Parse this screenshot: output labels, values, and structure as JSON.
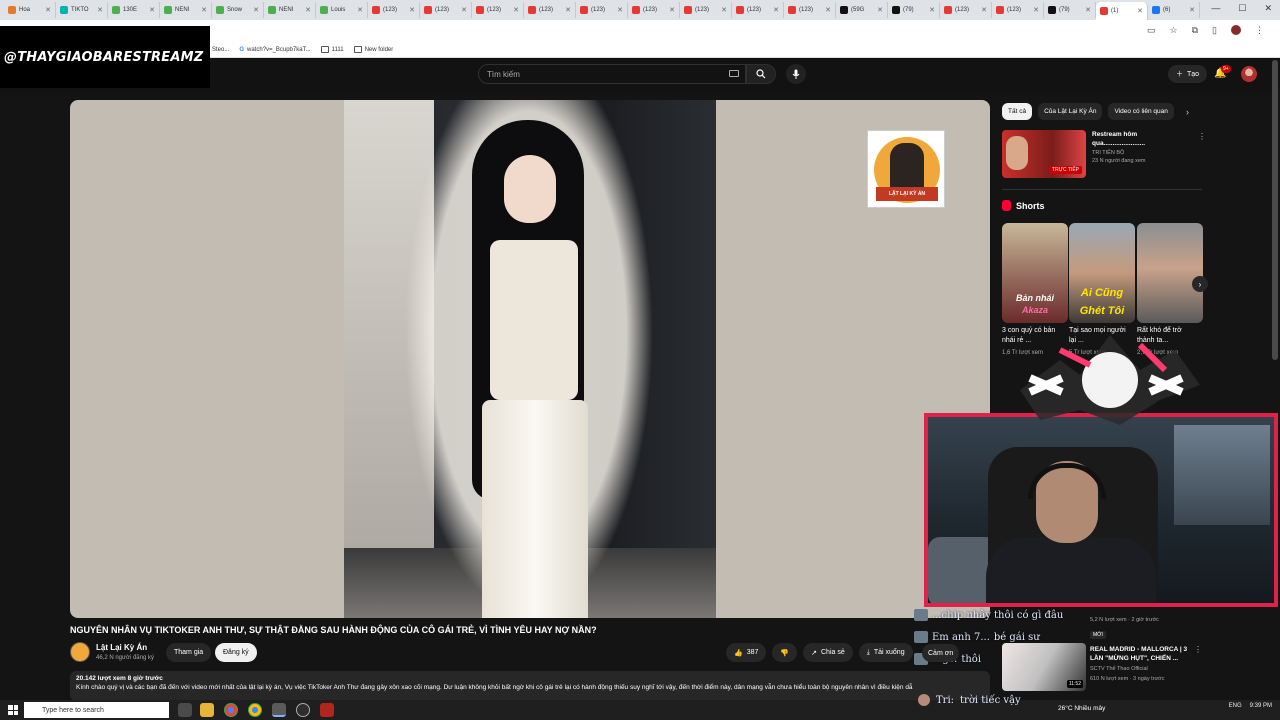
{
  "browser": {
    "tabs": [
      {
        "label": "Hoa",
        "color": "#e37b2b"
      },
      {
        "label": "TIKTO",
        "color": "#00b3b3"
      },
      {
        "label": "130E",
        "color": "#4caf50"
      },
      {
        "label": "NENI",
        "color": "#4caf50"
      },
      {
        "label": "Snow",
        "color": "#4caf50"
      },
      {
        "label": "NENI",
        "color": "#4caf50"
      },
      {
        "label": "Louis",
        "color": "#4caf50"
      },
      {
        "label": "(123)",
        "color": "#e53935"
      },
      {
        "label": "(123)",
        "color": "#e53935"
      },
      {
        "label": "(123)",
        "color": "#e53935"
      },
      {
        "label": "(123)",
        "color": "#e53935"
      },
      {
        "label": "(123)",
        "color": "#e53935"
      },
      {
        "label": "(123)",
        "color": "#e53935"
      },
      {
        "label": "(123)",
        "color": "#e53935"
      },
      {
        "label": "(123)",
        "color": "#e53935"
      },
      {
        "label": "(123)",
        "color": "#e53935"
      },
      {
        "label": "(59G",
        "color": "#111111"
      },
      {
        "label": "(79)",
        "color": "#111111"
      },
      {
        "label": "(123)",
        "color": "#e53935"
      },
      {
        "label": "(123)",
        "color": "#e53935"
      },
      {
        "label": "(79)",
        "color": "#111111"
      },
      {
        "label": "(1)",
        "color": "#e53935",
        "active": true
      },
      {
        "label": "(6)",
        "color": "#1877f2"
      }
    ],
    "bookmarks": [
      "Steo...",
      "watch?v=_Bcupb7kaT...",
      "1111",
      "New folder"
    ]
  },
  "watermark": "@THAYGIAOBARESTREAMZ",
  "header": {
    "search_placeholder": "Tìm kiếm",
    "create_label": "Tạo",
    "notif_count": "9+"
  },
  "player": {
    "logo_banner": "LẬT LẠI KỲ ÁN"
  },
  "video": {
    "title": "NGUYÊN NHÂN VỤ TIKTOKER ANH THƯ, SỰ THẬT ĐẰNG SAU HÀNH ĐỘNG CỦA CÔ GÁI TRẺ, VÌ TÌNH YÊU HAY NỢ NẦN?",
    "channel": "Lật Lại Kỳ Án",
    "subscribers": "46,2 N người đăng ký",
    "join_label": "Tham gia",
    "subscribe_label": "Đăng ký",
    "likes": "387",
    "thanks_label": "Cảm ơn",
    "share_label": "Chia sẻ",
    "download_label": "Tải xuống",
    "views_time": "20.142 lượt xem  8 giờ trước",
    "description": "Kính chào quý vị và các bạn đã đến với video mới nhất của lật lại kỳ án, Vụ việc TikToker Anh Thư đang gây xôn xao cõi mạng. Dư luận không khỏi bất ngờ khi cô gái trẻ lại có hành động thiếu suy nghĩ tới vậy, đến thời điểm này, dân mạng vẫn chưa hiểu toàn bộ nguyên nhân vì điều kiện dẫ"
  },
  "sidebar": {
    "chips": [
      "Tất cả",
      "Của Lật Lại Kỳ Án",
      "Video có liên quan"
    ],
    "recommendation": {
      "title": "Restream hôm qua.......................",
      "channel": "TRI TIẾN BỘ",
      "meta": "23 N người đang xem",
      "thumb_text": "TRỰC TIẾP"
    },
    "shorts_label": "Shorts",
    "shorts": [
      {
        "caption": "Bản nhái",
        "caption2": "Akaza",
        "title": "3 con quỷ có bản nhái rẻ ...",
        "views": "1,6 Tr lượt xem"
      },
      {
        "caption": "Ai Cũng",
        "caption2": "Ghét Tôi",
        "title": "Tại sao mọi người lại ...",
        "views": "5 Tr lượt xem"
      },
      {
        "caption": "",
        "caption2": "",
        "title": "Rất khó để trở thành ta...",
        "views": "2,7 Tr lượt xem"
      }
    ],
    "bottom_rec": {
      "title": "REAL MADRID - MALLORCA | 3 LẦN \"MỪNG HỤT\", CHIẾN ...",
      "channel": "SCTV Thể Thao Official",
      "meta": "610 N lượt xem · 3 ngày trước",
      "duration": "11:52"
    },
    "top_rec2": {
      "title": "...",
      "meta": "5,2 N lượt xem · 2 giờ trước",
      "badge": "MỚI"
    }
  },
  "stream_chat": [
    {
      "user": "",
      "text": "...chip nhây thôi có gì đâu"
    },
    {
      "user": "Em anh 7...",
      "text": "bé gái sư"
    },
    {
      "user": "dtgs:",
      "text": "thôi"
    }
  ],
  "bottom_chat": {
    "user": "Tri:",
    "text": "trời tiếc vậy"
  },
  "taskbar": {
    "search_placeholder": "Type here to search",
    "weather": "26°C  Nhiều mây",
    "lang": "ENG",
    "time": "9:39 PM"
  },
  "colors": {
    "accent_red": "#ff0033",
    "cam_border": "#e0224b"
  }
}
